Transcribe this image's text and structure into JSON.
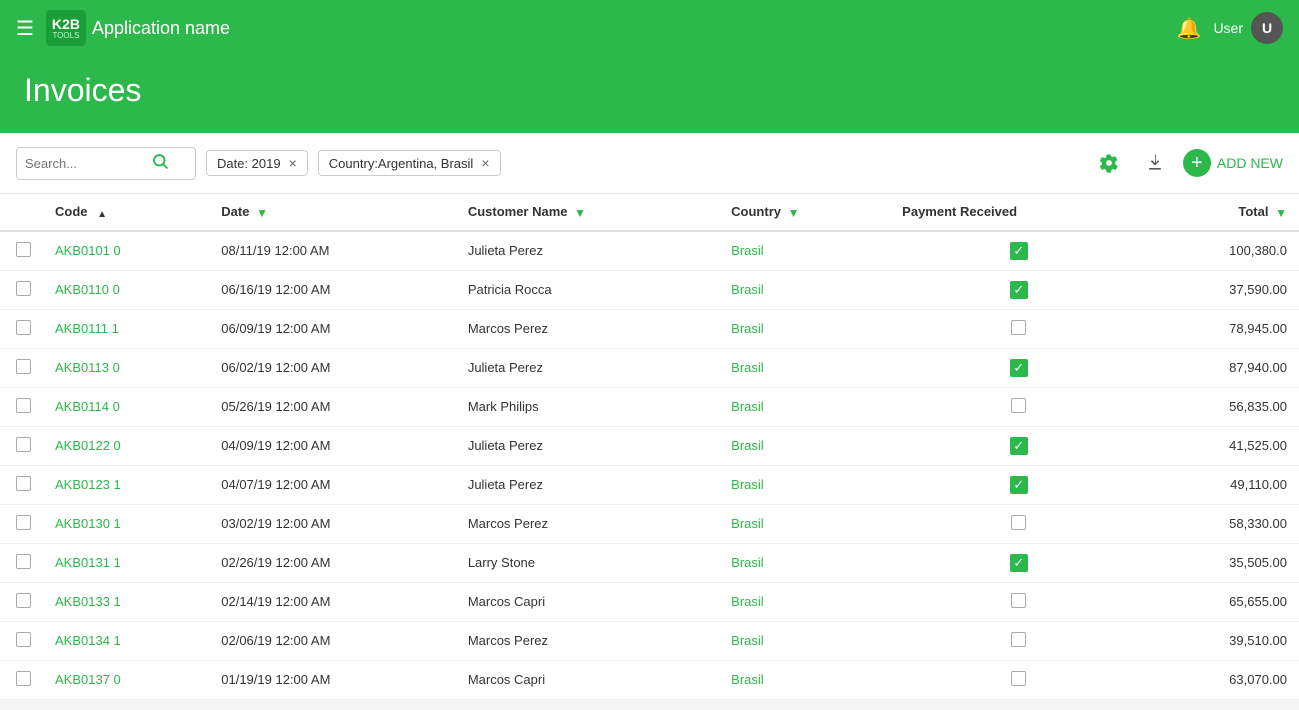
{
  "topnav": {
    "menu_label": "☰",
    "logo_k2b": "K2B",
    "logo_tools": "TOOLS",
    "app_name": "Application name",
    "bell_icon": "🔔",
    "user_label": "User",
    "avatar_label": "U"
  },
  "page": {
    "title": "Invoices"
  },
  "toolbar": {
    "search_placeholder": "Search...",
    "filter_date_label": "Date: 2019",
    "filter_country_label": "Country:Argentina, Brasil",
    "add_new_label": "ADD NEW"
  },
  "table": {
    "columns": [
      {
        "id": "check",
        "label": ""
      },
      {
        "id": "code",
        "label": "Code"
      },
      {
        "id": "date",
        "label": "Date"
      },
      {
        "id": "customer",
        "label": "Customer Name"
      },
      {
        "id": "country",
        "label": "Country"
      },
      {
        "id": "payment",
        "label": "Payment Received"
      },
      {
        "id": "total",
        "label": "Total"
      }
    ],
    "rows": [
      {
        "code": "AKB0101 0",
        "date": "08/11/19 12:00 AM",
        "customer": "Julieta Perez",
        "country": "Brasil",
        "payment_received": true,
        "total": "100,380.0"
      },
      {
        "code": "AKB0110 0",
        "date": "06/16/19 12:00 AM",
        "customer": "Patricia Rocca",
        "country": "Brasil",
        "payment_received": true,
        "total": "37,590.00"
      },
      {
        "code": "AKB0111 1",
        "date": "06/09/19 12:00 AM",
        "customer": "Marcos Perez",
        "country": "Brasil",
        "payment_received": false,
        "total": "78,945.00"
      },
      {
        "code": "AKB0113 0",
        "date": "06/02/19 12:00 AM",
        "customer": "Julieta Perez",
        "country": "Brasil",
        "payment_received": true,
        "total": "87,940.00"
      },
      {
        "code": "AKB0114 0",
        "date": "05/26/19 12:00 AM",
        "customer": "Mark Philips",
        "country": "Brasil",
        "payment_received": false,
        "total": "56,835.00"
      },
      {
        "code": "AKB0122 0",
        "date": "04/09/19 12:00 AM",
        "customer": "Julieta Perez",
        "country": "Brasil",
        "payment_received": true,
        "total": "41,525.00"
      },
      {
        "code": "AKB0123 1",
        "date": "04/07/19 12:00 AM",
        "customer": "Julieta Perez",
        "country": "Brasil",
        "payment_received": true,
        "total": "49,110.00"
      },
      {
        "code": "AKB0130 1",
        "date": "03/02/19 12:00 AM",
        "customer": "Marcos Perez",
        "country": "Brasil",
        "payment_received": false,
        "total": "58,330.00"
      },
      {
        "code": "AKB0131 1",
        "date": "02/26/19 12:00 AM",
        "customer": "Larry Stone",
        "country": "Brasil",
        "payment_received": true,
        "total": "35,505.00"
      },
      {
        "code": "AKB0133 1",
        "date": "02/14/19 12:00 AM",
        "customer": "Marcos Capri",
        "country": "Brasil",
        "payment_received": false,
        "total": "65,655.00"
      },
      {
        "code": "AKB0134 1",
        "date": "02/06/19 12:00 AM",
        "customer": "Marcos Perez",
        "country": "Brasil",
        "payment_received": false,
        "total": "39,510.00"
      },
      {
        "code": "AKB0137 0",
        "date": "01/19/19 12:00 AM",
        "customer": "Marcos Capri",
        "country": "Brasil",
        "payment_received": false,
        "total": "63,070.00"
      }
    ]
  }
}
